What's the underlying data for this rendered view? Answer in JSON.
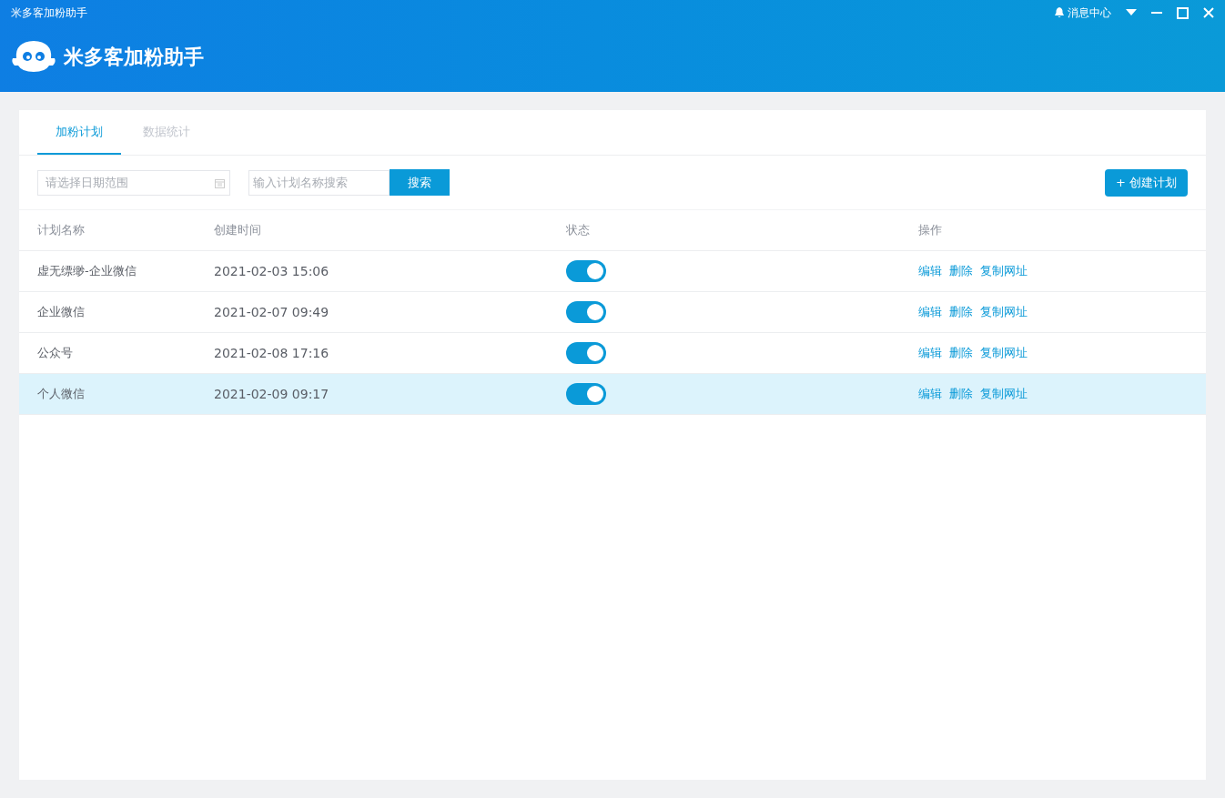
{
  "window": {
    "title": "米多客加粉助手",
    "notifications": "消息中心"
  },
  "header": {
    "brand": "米多客加粉助手"
  },
  "tabs": [
    {
      "label": "加粉计划",
      "selected": true
    },
    {
      "label": "数据统计",
      "selected": false
    }
  ],
  "toolbar": {
    "date_range": {
      "placeholder": "请选择日期范围"
    },
    "search": {
      "placeholder": "输入计划名称搜索"
    },
    "search_button": "搜索",
    "create_button": "+ 创建计划"
  },
  "table": {
    "columns": [
      "计划名称",
      "创建时间",
      "状态",
      "操作"
    ],
    "rows": [
      {
        "name": "虚无缥缈-企业微信",
        "created": "2021-02-03 15:06",
        "on": true,
        "selected": false,
        "actions": [
          "编辑",
          "删除",
          "复制网址"
        ]
      },
      {
        "name": "企业微信",
        "created": "2021-02-07 09:49",
        "on": true,
        "selected": false,
        "actions": [
          "编辑",
          "删除",
          "复制网址"
        ]
      },
      {
        "name": "公众号",
        "created": "2021-02-08 17:16",
        "on": true,
        "selected": false,
        "actions": [
          "编辑",
          "删除",
          "复制网址"
        ]
      },
      {
        "name": "个人微信",
        "created": "2021-02-09 09:17",
        "on": true,
        "selected": true,
        "actions": [
          "编辑",
          "删除",
          "复制网址"
        ]
      }
    ]
  }
}
